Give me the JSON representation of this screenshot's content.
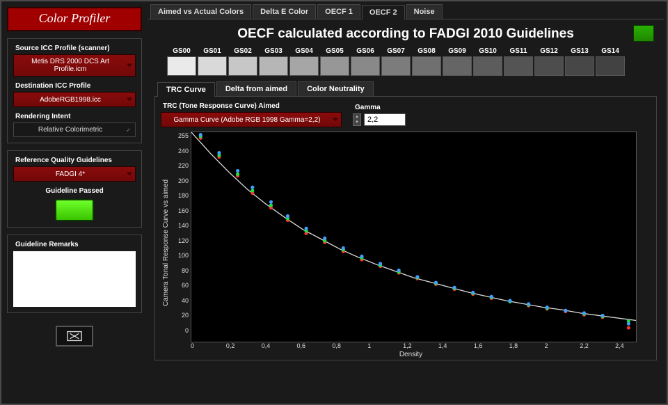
{
  "app_title": "Color Profiler",
  "sidebar": {
    "src_icc_label": "Source ICC Profile (scanner)",
    "src_icc_value": "Metis DRS 2000 DCS Art Profile.icm",
    "dst_icc_label": "Destination ICC Profile",
    "dst_icc_value": "AdobeRGB1998.icc",
    "intent_label": "Rendering Intent",
    "intent_value": "Relative Colorimetric",
    "ref_label": "Reference Quality Guidelines",
    "ref_value": "FADGI 4*",
    "passed_label": "Guideline Passed",
    "remarks_label": "Guideline Remarks"
  },
  "tabs": {
    "t0": "Aimed vs Actual Colors",
    "t1": "Delta E Color",
    "t2": "OECF 1",
    "t3": "OECF 2",
    "t4": "Noise"
  },
  "oecf_title": "OECF calculated according to FADGI 2010 Guidelines",
  "swatches": [
    {
      "label": "GS00",
      "c": "#eaeaea"
    },
    {
      "label": "GS01",
      "c": "#d9d9d9"
    },
    {
      "label": "GS02",
      "c": "#c7c7c7"
    },
    {
      "label": "GS03",
      "c": "#b6b6b6"
    },
    {
      "label": "GS04",
      "c": "#a6a6a6"
    },
    {
      "label": "GS05",
      "c": "#979797"
    },
    {
      "label": "GS06",
      "c": "#898989"
    },
    {
      "label": "GS07",
      "c": "#7c7c7c"
    },
    {
      "label": "GS08",
      "c": "#707070"
    },
    {
      "label": "GS09",
      "c": "#656565"
    },
    {
      "label": "GS10",
      "c": "#5c5c5c"
    },
    {
      "label": "GS11",
      "c": "#545454"
    },
    {
      "label": "GS12",
      "c": "#4d4d4d"
    },
    {
      "label": "GS13",
      "c": "#474747"
    },
    {
      "label": "GS14",
      "c": "#424242"
    }
  ],
  "sub_tabs": {
    "s0": "TRC Curve",
    "s1": "Delta from aimed",
    "s2": "Color Neutrality"
  },
  "trc": {
    "aimed_label": "TRC (Tone Response Curve) Aimed",
    "aimed_value": "Gamma Curve (Adobe RGB 1998 Gamma=2,2)",
    "gamma_label": "Gamma",
    "gamma_value": "2,2"
  },
  "chart_data": {
    "type": "line",
    "title": "",
    "xlabel": "Density",
    "ylabel": "Camera Tonal Response Curve vs aimed",
    "xlim": [
      0,
      2.4
    ],
    "ylim": [
      0,
      255
    ],
    "x_ticks": [
      "0",
      "0,2",
      "0,4",
      "0,6",
      "0,8",
      "1",
      "1,2",
      "1,4",
      "1,6",
      "1,8",
      "2",
      "2,2",
      "2,4"
    ],
    "y_ticks": [
      "255",
      "240",
      "220",
      "200",
      "180",
      "160",
      "140",
      "120",
      "100",
      "80",
      "60",
      "40",
      "20",
      "0"
    ],
    "aimed_curve_x": [
      0,
      0.1,
      0.2,
      0.3,
      0.4,
      0.5,
      0.6,
      0.7,
      0.8,
      0.9,
      1.0,
      1.1,
      1.2,
      1.3,
      1.4,
      1.5,
      1.6,
      1.7,
      1.8,
      1.9,
      2.0,
      2.1,
      2.2,
      2.3,
      2.4
    ],
    "aimed_curve_y": [
      255,
      230,
      207,
      186,
      168,
      152,
      137,
      125,
      113,
      103,
      94,
      86,
      78,
      72,
      66,
      60,
      55,
      50,
      46,
      42,
      39,
      35,
      32,
      29,
      26
    ],
    "series": [
      {
        "name": "R",
        "color": "#ff3030",
        "x": [
          0.05,
          0.15,
          0.25,
          0.33,
          0.43,
          0.52,
          0.62,
          0.72,
          0.82,
          0.92,
          1.02,
          1.12,
          1.22,
          1.32,
          1.42,
          1.52,
          1.62,
          1.72,
          1.82,
          1.92,
          2.02,
          2.12,
          2.22,
          2.36
        ],
        "y": [
          248,
          225,
          202,
          181,
          163,
          148,
          132,
          121,
          110,
          100,
          92,
          84,
          77,
          70,
          64,
          58,
          53,
          49,
          44,
          40,
          37,
          33,
          30,
          17
        ]
      },
      {
        "name": "G",
        "color": "#20e040",
        "x": [
          0.05,
          0.15,
          0.25,
          0.33,
          0.43,
          0.52,
          0.62,
          0.72,
          0.82,
          0.92,
          1.02,
          1.12,
          1.22,
          1.32,
          1.42,
          1.52,
          1.62,
          1.72,
          1.82,
          1.92,
          2.02,
          2.12,
          2.22,
          2.36
        ],
        "y": [
          250,
          227,
          204,
          184,
          166,
          150,
          135,
          123,
          112,
          102,
          93,
          85,
          78,
          71,
          65,
          59,
          54,
          49,
          45,
          41,
          38,
          34,
          31,
          25
        ]
      },
      {
        "name": "B",
        "color": "#40a0ff",
        "x": [
          0.05,
          0.15,
          0.25,
          0.33,
          0.43,
          0.52,
          0.62,
          0.72,
          0.82,
          0.92,
          1.02,
          1.12,
          1.22,
          1.32,
          1.42,
          1.52,
          1.62,
          1.72,
          1.82,
          1.92,
          2.02,
          2.12,
          2.22,
          2.36
        ],
        "y": [
          252,
          230,
          208,
          188,
          170,
          153,
          138,
          126,
          114,
          104,
          95,
          87,
          79,
          72,
          66,
          60,
          55,
          50,
          46,
          42,
          38,
          35,
          32,
          22
        ]
      }
    ]
  }
}
